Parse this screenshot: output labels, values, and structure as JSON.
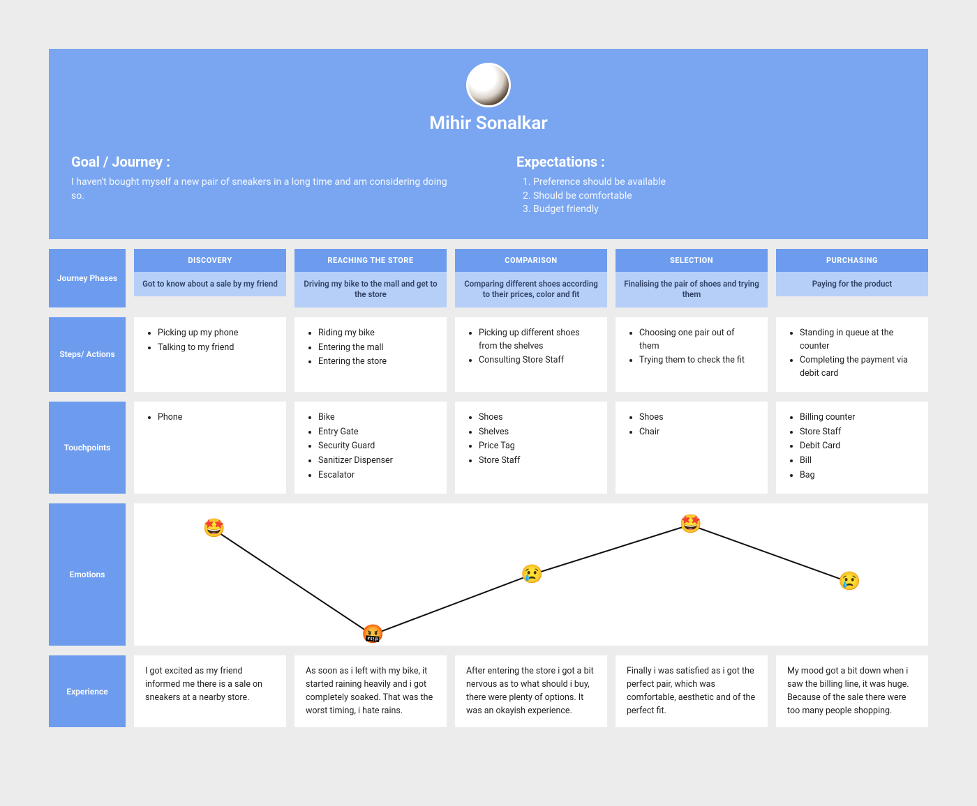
{
  "persona": {
    "name": "Mihir Sonalkar"
  },
  "goal": {
    "heading": "Goal / Journey :",
    "text": "I haven't bought myself a new pair of sneakers in a long time and am considering doing so."
  },
  "expectations": {
    "heading": "Expectations :",
    "items": [
      "Preference should be available",
      "Should be comfortable",
      "Budget friendly"
    ]
  },
  "rowLabels": {
    "phases": "Journey Phases",
    "steps": "Steps/ Actions",
    "touchpoints": "Touchpoints",
    "emotions": "Emotions",
    "experience": "Experience"
  },
  "phases": [
    {
      "title": "DISCOVERY",
      "subtitle": "Got to know about a sale by my friend"
    },
    {
      "title": "REACHING THE STORE",
      "subtitle": "Driving my bike to the mall and get to the store"
    },
    {
      "title": "COMPARISON",
      "subtitle": "Comparing different shoes according to their prices, color and fit"
    },
    {
      "title": "SELECTION",
      "subtitle": "Finalising the pair of shoes and trying them"
    },
    {
      "title": "PURCHASING",
      "subtitle": "Paying for the product"
    }
  ],
  "steps": [
    [
      "Picking up my phone",
      "Talking to my friend"
    ],
    [
      "Riding my bike",
      "Entering the mall",
      "Entering the store"
    ],
    [
      "Picking up different shoes from the shelves",
      "Consulting Store Staff"
    ],
    [
      "Choosing one pair out of them",
      "Trying them to check the fit"
    ],
    [
      "Standing in queue at the counter",
      "Completing the payment via debit card"
    ]
  ],
  "touchpoints": [
    [
      "Phone"
    ],
    [
      "Bike",
      "Entry Gate",
      "Security Guard",
      "Sanitizer Dispenser",
      "Escalator"
    ],
    [
      "Shoes",
      "Shelves",
      "Price Tag",
      "Store Staff"
    ],
    [
      "Shoes",
      "Chair"
    ],
    [
      "Billing counter",
      "Store Staff",
      "Debit Card",
      "Bill",
      "Bag"
    ]
  ],
  "experience": [
    "I got excited as my friend informed me there is a sale on sneakers at a nearby store.",
    "As soon as i left with my bike, it started raining heavily and i got completely soaked. That was the worst timing, i hate rains.",
    "After entering the store i got a bit nervous as to what should i buy, there were plenty of options. It was an okayish experience.",
    "Finally i was satisfied as i got the perfect pair, which was comfortable, aesthetic and of the perfect fit.",
    "My mood got a bit down when i saw the billing line, it was huge. Because of the sale there were too many people shopping."
  ],
  "emotions": {
    "points": [
      {
        "emoji": "🤩",
        "y": 18
      },
      {
        "emoji": "🤬",
        "y": 92
      },
      {
        "emoji": "😢",
        "y": 50
      },
      {
        "emoji": "🤩",
        "y": 15
      },
      {
        "emoji": "😢",
        "y": 55
      }
    ]
  }
}
